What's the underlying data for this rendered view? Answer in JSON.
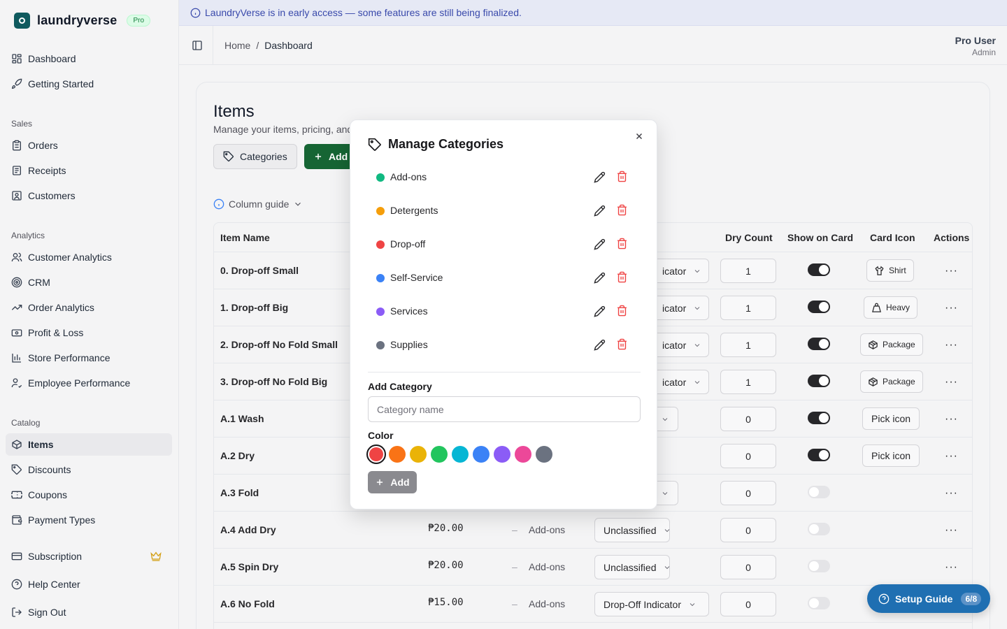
{
  "app": {
    "name": "laundryverse",
    "badge": "Pro"
  },
  "banner": {
    "text": "LaundryVerse is in early access — some features are still being finalized."
  },
  "header": {
    "breadcrumb_home": "Home",
    "breadcrumb_sep": "/",
    "breadcrumb_current": "Dashboard",
    "user_name": "Pro User",
    "user_role": "Admin"
  },
  "sidebar": {
    "top": [
      {
        "label": "Dashboard",
        "icon": "layout-grid-icon"
      },
      {
        "label": "Getting Started",
        "icon": "rocket-icon"
      }
    ],
    "sales_title": "Sales",
    "sales": [
      {
        "label": "Orders",
        "icon": "clipboard-icon"
      },
      {
        "label": "Receipts",
        "icon": "receipt-icon"
      },
      {
        "label": "Customers",
        "icon": "contact-icon"
      }
    ],
    "analytics_title": "Analytics",
    "analytics": [
      {
        "label": "Customer Analytics",
        "icon": "users-icon"
      },
      {
        "label": "CRM",
        "icon": "target-icon"
      },
      {
        "label": "Order Analytics",
        "icon": "trending-up-icon"
      },
      {
        "label": "Profit & Loss",
        "icon": "wallet-icon"
      },
      {
        "label": "Store Performance",
        "icon": "bar-chart-icon"
      },
      {
        "label": "Employee Performance",
        "icon": "user-check-icon"
      }
    ],
    "catalog_title": "Catalog",
    "catalog": [
      {
        "label": "Items",
        "icon": "box-icon"
      },
      {
        "label": "Discounts",
        "icon": "tag-icon"
      },
      {
        "label": "Coupons",
        "icon": "ticket-icon"
      },
      {
        "label": "Payment Types",
        "icon": "wallet-icon"
      }
    ],
    "bottom": [
      {
        "label": "Subscription",
        "icon": "credit-card-icon"
      },
      {
        "label": "Help Center",
        "icon": "help-circle-icon"
      },
      {
        "label": "Sign Out",
        "icon": "log-out-icon"
      }
    ]
  },
  "page": {
    "title": "Items",
    "subtitle": "Manage your items, pricing, and",
    "categories_button": "Categories",
    "add_button": "Add",
    "column_guide": "Column guide"
  },
  "table": {
    "headers": {
      "item_name": "Item Name",
      "dry_count": "Dry Count",
      "show_on_card": "Show on Card",
      "card_icon": "Card Icon",
      "actions": "Actions"
    },
    "rows": [
      {
        "name": "0. Drop-off Small",
        "select": "icator",
        "dry": "1",
        "show": true,
        "icon_label": "Shirt",
        "icon": "shirt-icon"
      },
      {
        "name": "1. Drop-off Big",
        "select": "icator",
        "dry": "1",
        "show": true,
        "icon_label": "Heavy",
        "icon": "weight-icon"
      },
      {
        "name": "2. Drop-off No Fold Small",
        "select": "icator",
        "dry": "1",
        "show": true,
        "icon_label": "Package",
        "icon": "package-icon"
      },
      {
        "name": "3. Drop-off No Fold Big",
        "select": "icator",
        "dry": "1",
        "show": true,
        "icon_label": "Package",
        "icon": "package-icon"
      },
      {
        "name": "A.1 Wash",
        "select": "",
        "dry": "0",
        "show": true,
        "icon_label": "Pick icon",
        "icon": ""
      },
      {
        "name": "A.2 Dry",
        "select": "",
        "dry": "0",
        "show": true,
        "icon_label": "Pick icon",
        "icon": ""
      },
      {
        "name": "A.3 Fold",
        "select": "",
        "dry": "0",
        "show": false,
        "icon_label": "",
        "icon": ""
      },
      {
        "name": "A.4 Add Dry",
        "price": "₱20.00",
        "dash": "–",
        "category": "Add-ons",
        "select": "Unclassified",
        "dry": "0",
        "show": false,
        "icon_label": "",
        "icon": ""
      },
      {
        "name": "A.5 Spin Dry",
        "price": "₱20.00",
        "dash": "–",
        "category": "Add-ons",
        "select": "Unclassified",
        "dry": "0",
        "show": false,
        "icon_label": "",
        "icon": ""
      },
      {
        "name": "A.6 No Fold",
        "price": "₱15.00",
        "dash": "–",
        "category": "Add-ons",
        "select": "Drop-Off Indicator",
        "dry": "0",
        "show": false,
        "icon_label": "",
        "icon": ""
      }
    ]
  },
  "modal": {
    "title": "Manage Categories",
    "categories": [
      {
        "name": "Add-ons",
        "color": "#10b981"
      },
      {
        "name": "Detergents",
        "color": "#f59e0b"
      },
      {
        "name": "Drop-off",
        "color": "#ef4444"
      },
      {
        "name": "Self-Service",
        "color": "#3b82f6"
      },
      {
        "name": "Services",
        "color": "#8b5cf6"
      },
      {
        "name": "Supplies",
        "color": "#6b7280"
      }
    ],
    "add_category_label": "Add Category",
    "input_placeholder": "Category name",
    "input_value": "",
    "color_label": "Color",
    "colors": [
      "#ef4444",
      "#f97316",
      "#eab308",
      "#22c55e",
      "#06b6d4",
      "#3b82f6",
      "#8b5cf6",
      "#ec4899",
      "#6b7280"
    ],
    "selected_color": "#ef4444",
    "add_button": "Add"
  },
  "setup_guide": {
    "label": "Setup Guide",
    "progress": "6/8"
  }
}
